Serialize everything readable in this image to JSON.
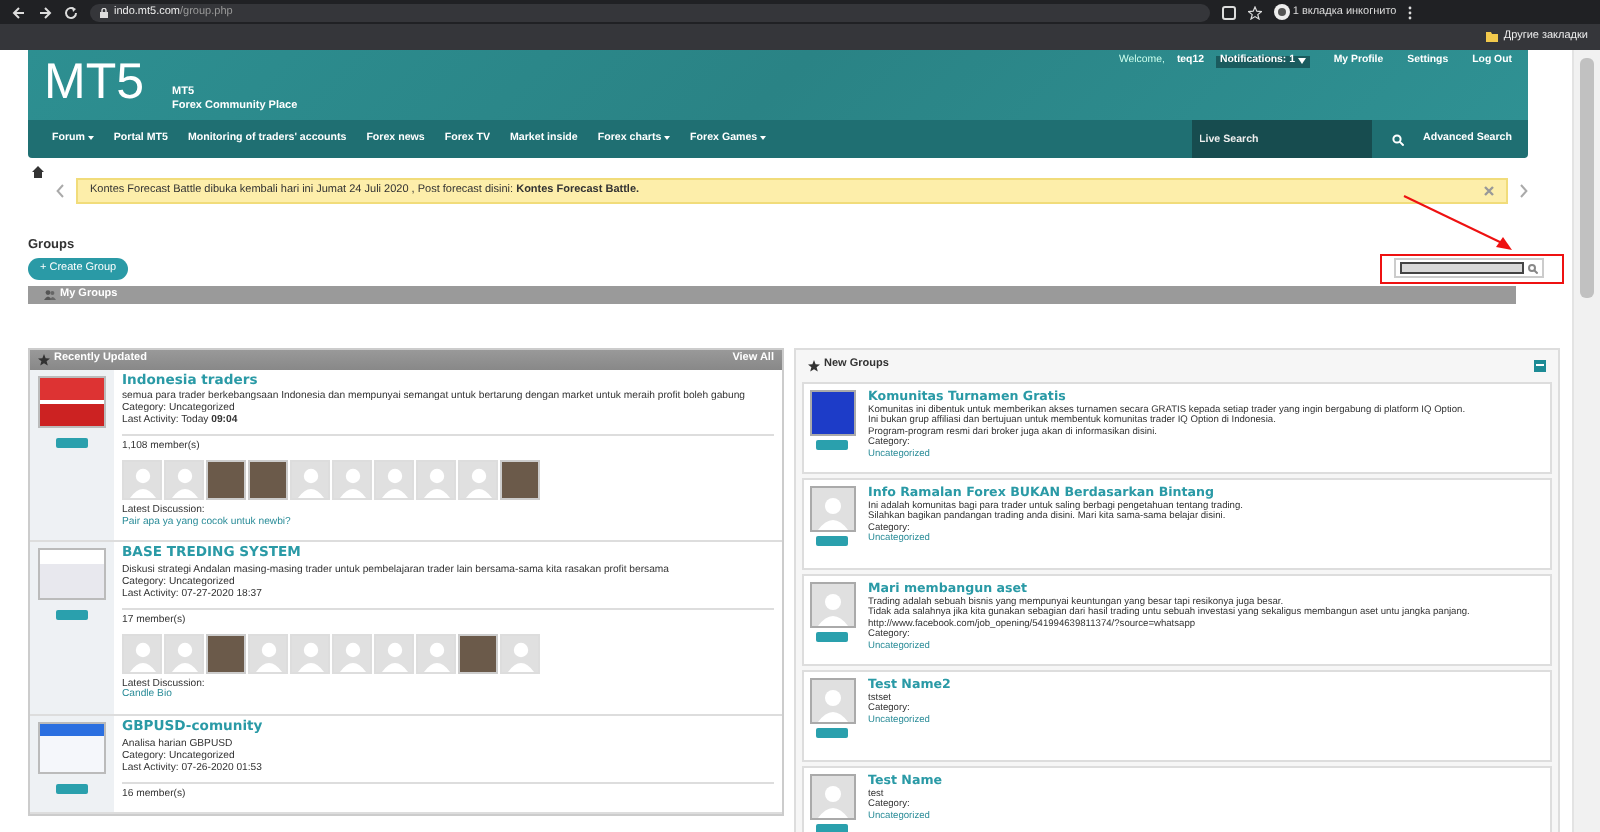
{
  "browser": {
    "url_host": "indo.mt5.com",
    "url_path": "/group.php",
    "profile": "1 вкладка инкогнито",
    "bookmarks": "Другие закладки"
  },
  "header": {
    "logo": "MT5",
    "site_name": "MT5",
    "tagline": "Forex Community Place",
    "welcome": "Welcome,",
    "username": "teq12",
    "notifications": "Notifications: 1",
    "links": [
      "My Profile",
      "Settings",
      "Log Out"
    ]
  },
  "nav": {
    "items": [
      {
        "label": "Forum",
        "dropdown": true
      },
      {
        "label": "Portal MT5",
        "dropdown": false
      },
      {
        "label": "Monitoring of traders' accounts",
        "dropdown": false
      },
      {
        "label": "Forex news",
        "dropdown": false
      },
      {
        "label": "Forex TV",
        "dropdown": false
      },
      {
        "label": "Market inside",
        "dropdown": false
      },
      {
        "label": "Forex charts",
        "dropdown": true
      },
      {
        "label": "Forex Games",
        "dropdown": true
      }
    ],
    "search_placeholder": "Live Search",
    "advanced_search": "Advanced Search"
  },
  "notice": {
    "text": "Kontes Forecast Battle dibuka kembali hari ini Jumat 24 Juli 2020 , Post forecast disini:",
    "link": "Kontes Forecast Battle."
  },
  "page_title": "Groups",
  "create_button": "+ Create Group",
  "my_groups": "My Groups",
  "recently_updated": {
    "title": "Recently Updated",
    "view_all": "View All",
    "groups": [
      {
        "name": "Indonesia traders",
        "thumb": {
          "kind": "image"
        },
        "description": "semua para trader berkebangsaan Indonesia dan mempunyai semangat untuk bertarung dengan market untuk meraih profit boleh gabung",
        "category_label": "Category:",
        "category": "Uncategorized",
        "activity": "Last Activity: Today **09:04**",
        "members": "1,108 member(s)",
        "avatars": [
          {
            "kind": "blank"
          },
          {
            "kind": "blank"
          },
          {
            "kind": "photo"
          },
          {
            "kind": "photo"
          },
          {
            "kind": "blank"
          },
          {
            "kind": "blank"
          },
          {
            "kind": "blank"
          },
          {
            "kind": "blank"
          },
          {
            "kind": "blank"
          },
          {
            "kind": "photo"
          }
        ],
        "discussion_label": "Latest Discussion:",
        "discussion": "Pair apa ya yang cocok untuk newbi?"
      },
      {
        "name": "BASE TREDING SYSTEM",
        "thumb": {
          "kind": "image"
        },
        "description": "Diskusi strategi Andalan masing-masing trader untuk pembelajaran trader lain bersama-sama kita rasakan profit bersama",
        "category_label": "Category:",
        "category": "Uncategorized",
        "activity": "Last Activity: 07-27-2020 18:37",
        "members": "17 member(s)",
        "avatars": [
          {
            "kind": "blank"
          },
          {
            "kind": "blank"
          },
          {
            "kind": "photo"
          },
          {
            "kind": "blank"
          },
          {
            "kind": "blank"
          },
          {
            "kind": "blank"
          },
          {
            "kind": "blank"
          },
          {
            "kind": "blank"
          },
          {
            "kind": "photo"
          },
          {
            "kind": "blank"
          }
        ],
        "discussion_label": "Latest Discussion:",
        "discussion": "Candle Bio"
      },
      {
        "name": "GBPUSD-comunity",
        "thumb": {
          "kind": "image"
        },
        "description": "Analisa harian GBPUSD",
        "category_label": "Category:",
        "category": "Uncategorized",
        "activity": "Last Activity: 07-26-2020 01:53",
        "members": "16 member(s)"
      }
    ]
  },
  "new_groups": {
    "title": "New Groups",
    "groups": [
      {
        "name": "Komunitas Turnamen Gratis",
        "thumb": {
          "kind": "image"
        },
        "lines": [
          "Komunitas ini dibentuk untuk memberikan akses turnamen secara GRATIS kepada setiap trader yang ingin bergabung di platform IQ Option.",
          "Ini bukan grup affiliasi dan bertujuan untuk membentuk komunitas trader IQ Option di Indonesia.",
          "Program-program resmi dari broker juga akan di informasikan disini."
        ],
        "category_label": "Category:",
        "category": "Uncategorized"
      },
      {
        "name": "Info Ramalan Forex BUKAN Berdasarkan Bintang",
        "thumb": {
          "kind": "blank"
        },
        "lines": [
          "Ini adalah komunitas bagi para trader untuk saling berbagi pengetahuan tentang trading.",
          "Silahkan bagikan pandangan trading anda disini. Mari kita sama-sama belajar disini."
        ],
        "category_label": "Category:",
        "category": "Uncategorized"
      },
      {
        "name": "Mari membangun aset",
        "thumb": {
          "kind": "blank"
        },
        "lines": [
          "Trading adalah sebuah bisnis yang mempunyai keuntungan yang besar tapi resikonya juga besar.",
          "Tidak ada salahnya jika kita gunakan sebagian dari hasil trading untu sebuah investasi yang sekaligus membangun aset untu jangka panjang.",
          "http://www.facebook.com/job_opening/541994639811374/?source=whatsapp"
        ],
        "category_label": "Category:",
        "category": "Uncategorized"
      },
      {
        "name": "Test Name2",
        "thumb": {
          "kind": "blank"
        },
        "lines": [
          "tstset"
        ],
        "category_label": "Category:",
        "category": "Uncategorized"
      },
      {
        "name": "Test Name",
        "thumb": {
          "kind": "blank"
        },
        "lines": [
          "test"
        ],
        "category_label": "Category:",
        "category": "Uncategorized"
      }
    ]
  }
}
